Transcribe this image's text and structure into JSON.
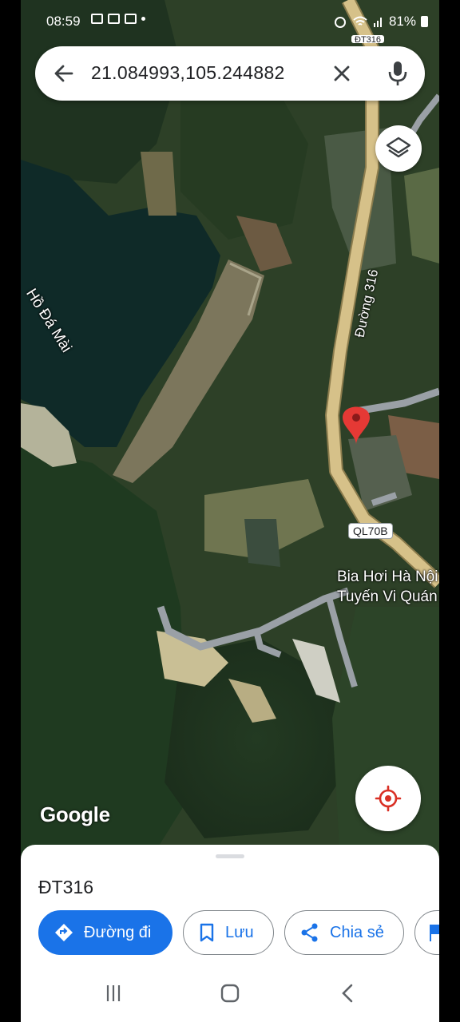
{
  "status_bar": {
    "time": "08:59",
    "battery": "81%"
  },
  "search": {
    "query": "21.084993,105.244882"
  },
  "map": {
    "lake_label": "Hồ Đá Mài",
    "road_label": "Đường 316",
    "road_badge": "QL70B",
    "top_badge": "ĐT316",
    "poi_line1": "Bia Hơi Hà Nội",
    "poi_line2": "Tuyến Vi Quán",
    "attribution": "Google",
    "pin_color": "#e53935"
  },
  "sheet": {
    "title": "ĐT316",
    "directions_label": "Đường đi",
    "save_label": "Lưu",
    "share_label": "Chia sẻ"
  },
  "colors": {
    "accent": "#1a73e8",
    "road": "#d6c189"
  },
  "icons": {
    "back": "arrow-left-icon",
    "clear": "close-icon",
    "mic": "microphone-icon",
    "layers": "layers-icon",
    "locate": "my-location-icon",
    "directions": "directions-icon",
    "save": "bookmark-icon",
    "share": "share-icon"
  }
}
